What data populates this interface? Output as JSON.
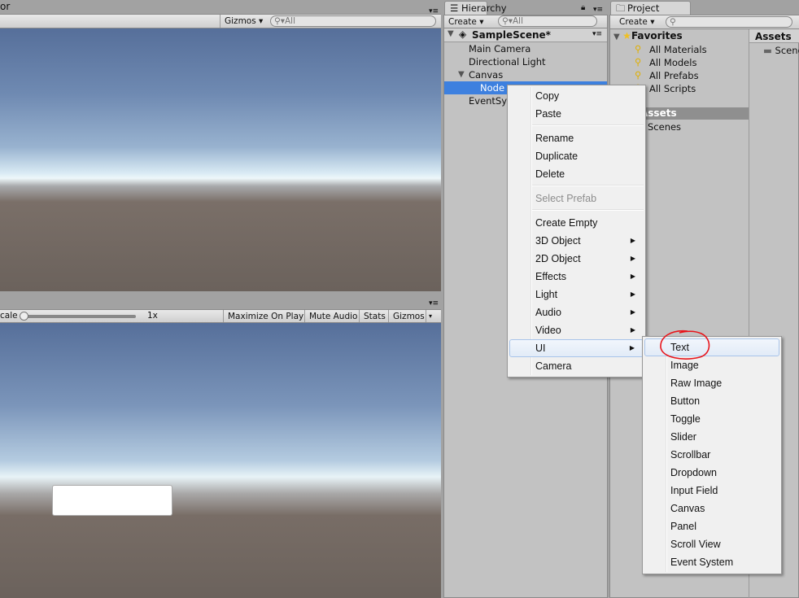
{
  "scene": {
    "tab_fragment": "or",
    "gizmos": "Gizmos ▾",
    "search": "All"
  },
  "game": {
    "scale_label": "cale",
    "scale_value": "1x",
    "maximize": "Maximize On Play",
    "mute": "Mute Audio",
    "stats": "Stats",
    "gizmos": "Gizmos"
  },
  "hierarchy": {
    "tab": "Hierarchy",
    "create": "Create ▾",
    "search": "All",
    "scene": "SampleScene*",
    "items": [
      "Main Camera",
      "Directional Light",
      "Canvas",
      "Node",
      "EventSystem"
    ]
  },
  "project": {
    "tab": "Project",
    "create": "Create ▾",
    "favorites": "Favorites",
    "fav_items": [
      "All Materials",
      "All Models",
      "All Prefabs",
      "All Scripts"
    ],
    "assets_header": "Assets",
    "assets_tree": [
      "Assets",
      "Scenes"
    ],
    "assets_grid": [
      "Scenes"
    ]
  },
  "context_menu": {
    "items": [
      {
        "label": "Copy"
      },
      {
        "label": "Paste"
      },
      {
        "sep": true
      },
      {
        "label": "Rename"
      },
      {
        "label": "Duplicate"
      },
      {
        "label": "Delete"
      },
      {
        "sep": true
      },
      {
        "label": "Select Prefab",
        "disabled": true
      },
      {
        "sep": true
      },
      {
        "label": "Create Empty"
      },
      {
        "label": "3D Object",
        "sub": true
      },
      {
        "label": "2D Object",
        "sub": true
      },
      {
        "label": "Effects",
        "sub": true
      },
      {
        "label": "Light",
        "sub": true
      },
      {
        "label": "Audio",
        "sub": true
      },
      {
        "label": "Video",
        "sub": true
      },
      {
        "label": "UI",
        "sub": true,
        "highlight": true
      },
      {
        "label": "Camera"
      }
    ]
  },
  "ui_submenu": {
    "items": [
      "Text",
      "Image",
      "Raw Image",
      "Button",
      "Toggle",
      "Slider",
      "Scrollbar",
      "Dropdown",
      "Input Field",
      "Canvas",
      "Panel",
      "Scroll View",
      "Event System"
    ],
    "highlighted": "Text",
    "annotation_color": "#e8141a"
  },
  "colors": {
    "selection": "#3d80df",
    "panel": "#c2c2c2"
  }
}
